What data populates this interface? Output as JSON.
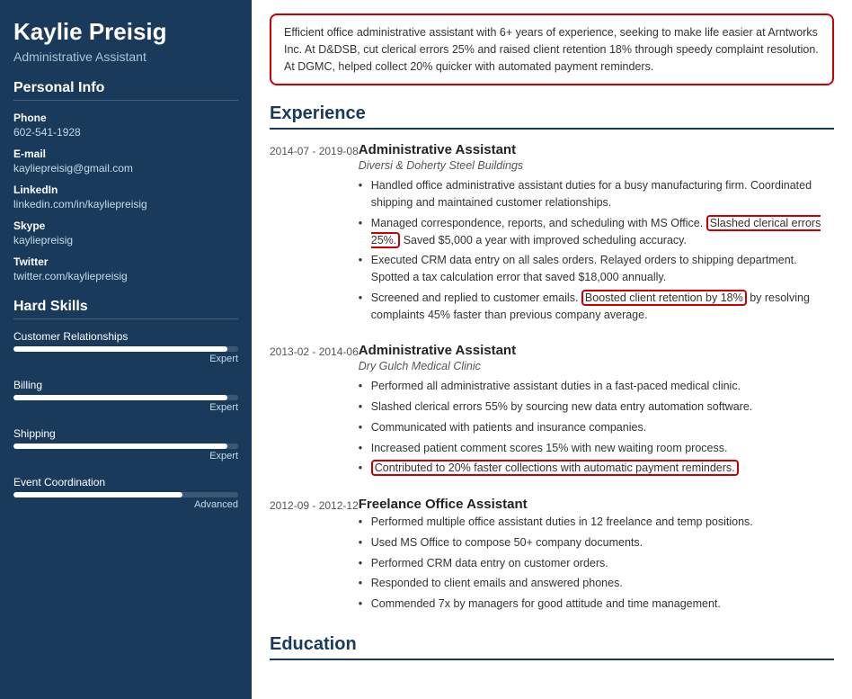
{
  "sidebar": {
    "name": "Kaylie Preisig",
    "title": "Administrative Assistant",
    "sections": {
      "personal_info": {
        "label": "Personal Info",
        "fields": [
          {
            "label": "Phone",
            "value": "602-541-1928"
          },
          {
            "label": "E-mail",
            "value": "kayliepreisig@gmail.com"
          },
          {
            "label": "LinkedIn",
            "value": "linkedin.com/in/kayliepreisig"
          },
          {
            "label": "Skype",
            "value": "kayliepreisig"
          },
          {
            "label": "Twitter",
            "value": "twitter.com/kayliepreisig"
          }
        ]
      },
      "hard_skills": {
        "label": "Hard Skills",
        "skills": [
          {
            "name": "Customer Relationships",
            "percent": 95,
            "level": "Expert"
          },
          {
            "name": "Billing",
            "percent": 95,
            "level": "Expert"
          },
          {
            "name": "Shipping",
            "percent": 95,
            "level": "Expert"
          },
          {
            "name": "Event Coordination",
            "percent": 75,
            "level": "Advanced"
          }
        ]
      }
    }
  },
  "main": {
    "summary": "Efficient office administrative assistant with 6+ years of experience, seeking to make life easier at Arntworks Inc. At D&DSB, cut clerical errors 25% and raised client retention 18% through speedy complaint resolution. At DGMC, helped collect 20% quicker with automated payment reminders.",
    "experience_label": "Experience",
    "experience": [
      {
        "date": "2014-07 - 2019-08",
        "title": "Administrative Assistant",
        "company": "Diversi & Doherty Steel Buildings",
        "bullets": [
          "Handled office administrative assistant duties for a busy manufacturing firm. Coordinated shipping and maintained customer relationships.",
          "Managed correspondence, reports, and scheduling with MS Office. Slashed clerical errors 25%. Saved $5,000 a year with improved scheduling accuracy.",
          "Executed CRM data entry on all sales orders. Relayed orders to shipping department. Spotted a tax calculation error that saved $18,000 annually.",
          "Screened and replied to customer emails. Boosted client retention by 18% by resolving complaints 45% faster than previous company average."
        ],
        "highlights": {
          "bullet1": {
            "pre": "Managed correspondence, reports, and scheduling with MS Office. ",
            "highlight": "Slashed clerical errors 25%.",
            "post": " Saved $5,000 a year with improved scheduling accuracy."
          },
          "bullet3": {
            "pre": "Screened and replied to customer emails. ",
            "highlight": "Boosted client retention by 18%",
            "post": " by resolving complaints 45% faster than previous company average."
          }
        }
      },
      {
        "date": "2013-02 - 2014-06",
        "title": "Administrative Assistant",
        "company": "Dry Gulch Medical Clinic",
        "bullets": [
          "Performed all administrative assistant duties in a fast-paced medical clinic.",
          "Slashed clerical errors 55% by sourcing new data entry automation software.",
          "Communicated with patients and insurance companies.",
          "Increased patient comment scores 15% with new waiting room process.",
          "Contributed to 20% faster collections with automatic payment reminders."
        ]
      },
      {
        "date": "2012-09 - 2012-12",
        "title": "Freelance Office Assistant",
        "company": "",
        "bullets": [
          "Performed multiple office assistant duties in 12 freelance and temp positions.",
          "Used MS Office to compose 50+ company documents.",
          "Performed CRM data entry on customer orders.",
          "Responded to client emails and answered phones.",
          "Commended 7x by managers for good attitude and time management."
        ]
      }
    ],
    "education_label": "Education"
  }
}
